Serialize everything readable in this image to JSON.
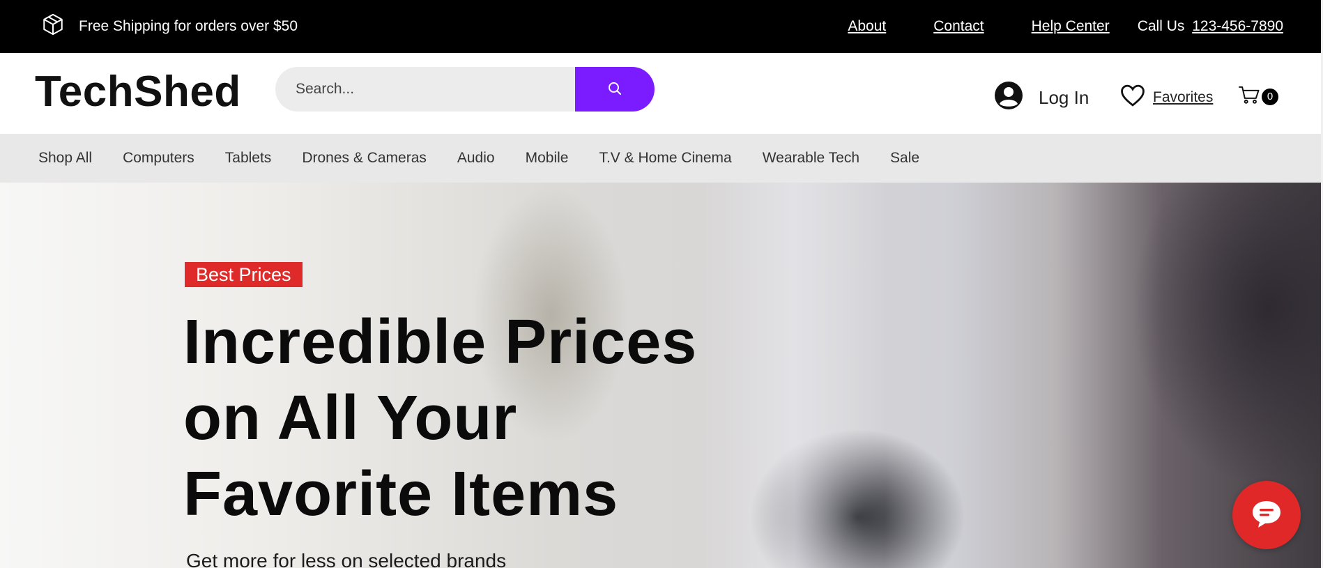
{
  "topbar": {
    "shipping_text": "Free Shipping for orders over $50",
    "links": [
      "About",
      "Contact",
      "Help Center"
    ],
    "call_label": "Call Us",
    "phone": "123-456-7890"
  },
  "header": {
    "logo": "TechShed",
    "search_placeholder": "Search...",
    "login_label": "Log In",
    "favorites_label": "Favorites",
    "cart_count": "0"
  },
  "nav": {
    "items": [
      "Shop All",
      "Computers",
      "Tablets",
      "Drones & Cameras",
      "Audio",
      "Mobile",
      "T.V & Home Cinema",
      "Wearable Tech",
      "Sale"
    ]
  },
  "hero": {
    "badge": "Best Prices",
    "title_line1": "Incredible Prices",
    "title_line2": "on All Your",
    "title_line3": "Favorite Items",
    "subtitle": "Get more for less on selected brands"
  },
  "colors": {
    "accent": "#7a1cff",
    "badge_red": "#df2a2a",
    "chat_red": "#e02828",
    "topbar_bg": "#000000",
    "nav_bg": "#e8e8e8"
  },
  "icons": {
    "shipping": "box-icon",
    "search": "search-icon",
    "account": "user-icon",
    "favorites": "heart-icon",
    "cart": "cart-icon",
    "chat": "chat-icon"
  }
}
